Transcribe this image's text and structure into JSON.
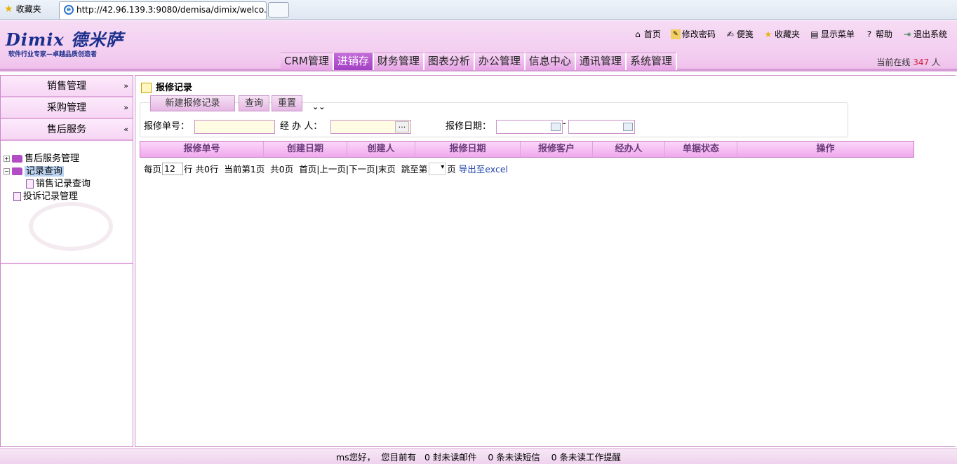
{
  "browser": {
    "favorites_label": "收藏夹",
    "tab_title": "http://42.96.139.3:9080/demisa/dimix/welco..."
  },
  "header": {
    "logo_main": "Dimix 德米萨",
    "logo_sub": "软件行业专家—卓越品质创造者",
    "top_links": [
      "首页",
      "修改密码",
      "便笺",
      "收藏夹",
      "显示菜单",
      "帮助",
      "退出系统"
    ],
    "nav_tabs": [
      "CRM管理",
      "进销存",
      "财务管理",
      "图表分析",
      "办公管理",
      "信息中心",
      "通讯管理",
      "系统管理"
    ],
    "active_tab": "进销存",
    "online_prefix": "当前在线",
    "online_count": "347",
    "online_suffix": "人"
  },
  "sidebar": {
    "sections": [
      "销售管理",
      "采购管理",
      "售后服务"
    ],
    "tree": [
      "售后服务管理",
      "记录查询",
      "销售记录查询",
      "投诉记录管理"
    ]
  },
  "content": {
    "title": "报修记录",
    "buttons": [
      "新建报修记录",
      "查询",
      "重置"
    ],
    "labels": {
      "order_no": "报修单号：",
      "handler": "经 办 人：",
      "date": "报修日期：",
      "date_sep": "-"
    },
    "columns": [
      "报修单号",
      "创建日期",
      "创建人",
      "报修日期",
      "报修客户",
      "经办人",
      "单据状态",
      "操作"
    ],
    "pager": {
      "per_page_label": "每页",
      "per_page": "12",
      "rows_text": "行 共0行  当前第1页  共0页  首页|上一页|下一页|末页  跳至第",
      "page_label": "页",
      "export": "导出至excel"
    }
  },
  "status": "ms您好，  您目前有   0 封未读邮件    0 条未读短信    0 条未读工作提醒"
}
